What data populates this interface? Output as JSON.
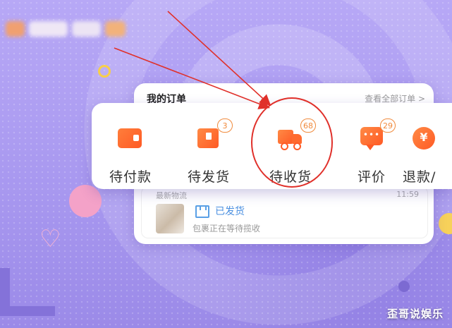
{
  "orders": {
    "title": "我的订单",
    "view_all": "查看全部订单 >"
  },
  "status_items": [
    {
      "label": "待付款",
      "icon": "wallet-icon",
      "badge": null
    },
    {
      "label": "待发货",
      "icon": "box-icon",
      "badge": "3"
    },
    {
      "label": "待收货",
      "icon": "truck-icon",
      "badge": "68"
    },
    {
      "label": "评价",
      "icon": "chat-bubble-icon",
      "badge": "29"
    },
    {
      "label": "退款/",
      "icon": "refund-icon",
      "badge": null
    }
  ],
  "logistics": {
    "label": "最新物流",
    "time": "11:59",
    "status": "已发货",
    "description": "包裹正在等待揽收"
  },
  "watermark": "歪哥说娱乐",
  "colors": {
    "accent_orange": "#ff5a25",
    "badge_orange": "#f08a3c",
    "status_blue": "#4a8fe0",
    "annotation_red": "#e0302a",
    "background_purple": "#a99af0"
  }
}
